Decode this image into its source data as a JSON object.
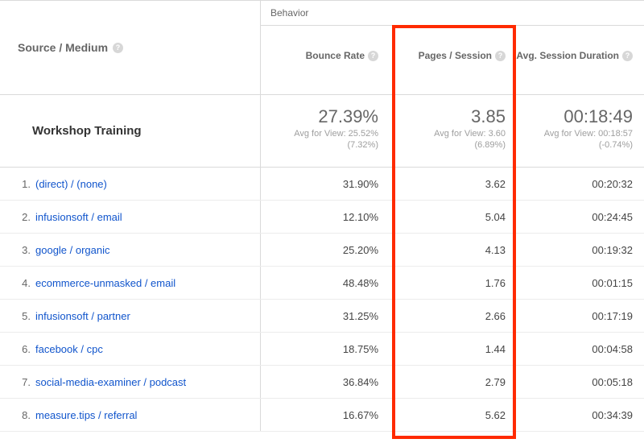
{
  "dim_header": "Source / Medium",
  "metrics_group": "Behavior",
  "columns": {
    "bounce": "Bounce Rate",
    "pages": "Pages / Session",
    "duration": "Avg. Session Duration"
  },
  "summary": {
    "label": "Workshop Training",
    "bounce": {
      "value": "27.39%",
      "avg": "Avg for View: 25.52%",
      "delta": "(7.32%)"
    },
    "pages": {
      "value": "3.85",
      "avg": "Avg for View: 3.60",
      "delta": "(6.89%)"
    },
    "duration": {
      "value": "00:18:49",
      "avg": "Avg for View: 00:18:57",
      "delta": "(-0.74%)"
    }
  },
  "rows": [
    {
      "n": "1.",
      "label": "(direct) / (none)",
      "bounce": "31.90%",
      "pages": "3.62",
      "duration": "00:20:32"
    },
    {
      "n": "2.",
      "label": "infusionsoft / email",
      "bounce": "12.10%",
      "pages": "5.04",
      "duration": "00:24:45"
    },
    {
      "n": "3.",
      "label": "google / organic",
      "bounce": "25.20%",
      "pages": "4.13",
      "duration": "00:19:32"
    },
    {
      "n": "4.",
      "label": "ecommerce-unmasked / email",
      "bounce": "48.48%",
      "pages": "1.76",
      "duration": "00:01:15"
    },
    {
      "n": "5.",
      "label": "infusionsoft / partner",
      "bounce": "31.25%",
      "pages": "2.66",
      "duration": "00:17:19"
    },
    {
      "n": "6.",
      "label": "facebook / cpc",
      "bounce": "18.75%",
      "pages": "1.44",
      "duration": "00:04:58"
    },
    {
      "n": "7.",
      "label": "social-media-examiner / podcast",
      "bounce": "36.84%",
      "pages": "2.79",
      "duration": "00:05:18"
    },
    {
      "n": "8.",
      "label": "measure.tips / referral",
      "bounce": "16.67%",
      "pages": "5.62",
      "duration": "00:34:39"
    }
  ],
  "chart_data": {
    "type": "table",
    "title": "Workshop Training — Behavior by Source / Medium",
    "columns": [
      "Source / Medium",
      "Bounce Rate (%)",
      "Pages / Session",
      "Avg. Session Duration (s)"
    ],
    "summary": {
      "bounce_rate": 27.39,
      "pages_per_session": 3.85,
      "avg_session_duration_s": 1129,
      "view_avg": {
        "bounce_rate": 25.52,
        "pages_per_session": 3.6,
        "avg_session_duration_s": 1137
      },
      "delta_pct": {
        "bounce_rate": 7.32,
        "pages_per_session": 6.89,
        "avg_session_duration_s": -0.74
      }
    },
    "rows": [
      {
        "source_medium": "(direct) / (none)",
        "bounce_rate": 31.9,
        "pages_per_session": 3.62,
        "avg_session_duration_s": 1232
      },
      {
        "source_medium": "infusionsoft / email",
        "bounce_rate": 12.1,
        "pages_per_session": 5.04,
        "avg_session_duration_s": 1485
      },
      {
        "source_medium": "google / organic",
        "bounce_rate": 25.2,
        "pages_per_session": 4.13,
        "avg_session_duration_s": 1172
      },
      {
        "source_medium": "ecommerce-unmasked / email",
        "bounce_rate": 48.48,
        "pages_per_session": 1.76,
        "avg_session_duration_s": 75
      },
      {
        "source_medium": "infusionsoft / partner",
        "bounce_rate": 31.25,
        "pages_per_session": 2.66,
        "avg_session_duration_s": 1039
      },
      {
        "source_medium": "facebook / cpc",
        "bounce_rate": 18.75,
        "pages_per_session": 1.44,
        "avg_session_duration_s": 298
      },
      {
        "source_medium": "social-media-examiner / podcast",
        "bounce_rate": 36.84,
        "pages_per_session": 2.79,
        "avg_session_duration_s": 318
      },
      {
        "source_medium": "measure.tips / referral",
        "bounce_rate": 16.67,
        "pages_per_session": 5.62,
        "avg_session_duration_s": 2079
      }
    ],
    "highlighted_column": "Pages / Session"
  }
}
